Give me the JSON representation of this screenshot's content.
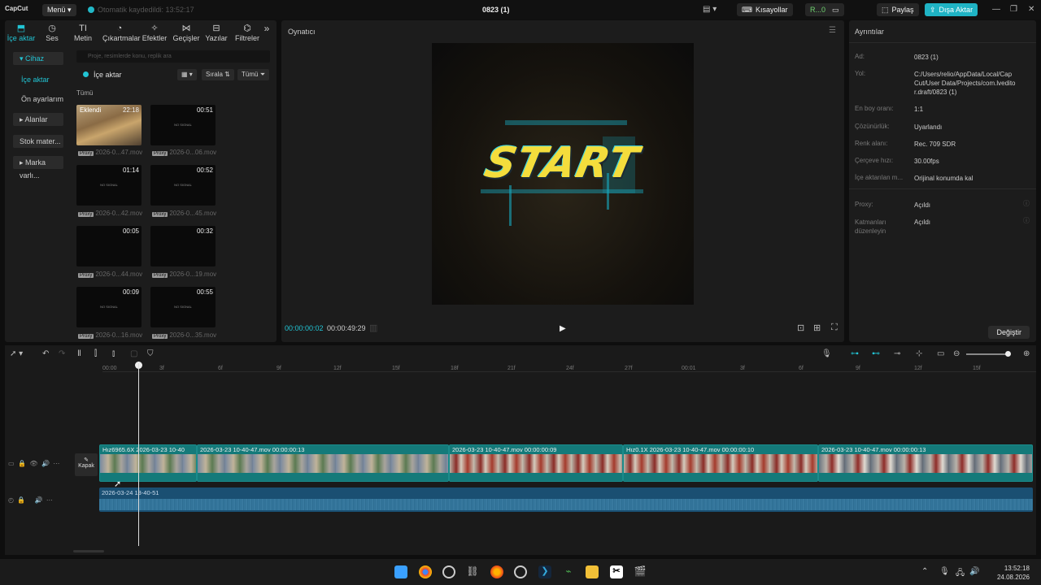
{
  "titlebar": {
    "logo": "CapCut",
    "menu": "Menü",
    "autosave": "Otomatik kaydedildi: 13:52:17",
    "project_title": "0823 (1)",
    "shortcuts": "Kısayollar",
    "ai_label": "R...0",
    "share": "Paylaş",
    "export": "Dışa Aktar"
  },
  "media_panel": {
    "tabs": [
      {
        "label": "İçe aktar",
        "icon": "import-icon"
      },
      {
        "label": "Ses",
        "icon": "audio-icon"
      },
      {
        "label": "Metin",
        "icon": "text-icon"
      },
      {
        "label": "Çıkartmalar",
        "icon": "sticker-icon"
      },
      {
        "label": "Efektler",
        "icon": "effects-icon"
      },
      {
        "label": "Geçişler",
        "icon": "transitions-icon"
      },
      {
        "label": "Yazılar",
        "icon": "captions-icon"
      },
      {
        "label": "Filtreler",
        "icon": "filters-icon"
      }
    ],
    "sidebar": [
      "Cihaz",
      "İçe aktar",
      "Ön ayarlarım",
      "Alanlar",
      "Stok mater...",
      "Marka varlı..."
    ],
    "search_placeholder": "Proje, resimlerde konu, replik ara",
    "import_label": "İçe aktar",
    "sort_label": "Sırala",
    "filter_label": "Tümü",
    "all_label": "Tümü",
    "items": [
      {
        "duration": "22:18",
        "name": "2026-0...47.mov",
        "proxy": "Proxy",
        "added": "Eklendi"
      },
      {
        "duration": "00:51",
        "name": "2026-0...06.mov",
        "proxy": "Proxy"
      },
      {
        "duration": "01:14",
        "name": "2026-0...42.mov",
        "proxy": "Proxy"
      },
      {
        "duration": "00:52",
        "name": "2026-0...45.mov",
        "proxy": "Proxy"
      },
      {
        "duration": "00:05",
        "name": "2026-0...44.mov",
        "proxy": "Proxy"
      },
      {
        "duration": "00:32",
        "name": "2026-0...19.mov",
        "proxy": "Proxy"
      },
      {
        "duration": "00:09",
        "name": "2026-0...16.mov",
        "proxy": "Proxy"
      },
      {
        "duration": "00:55",
        "name": "2026-0...35.mov",
        "proxy": "Proxy"
      }
    ],
    "no_signal": "NO SIGNAL"
  },
  "player": {
    "title": "Oynatıcı",
    "overlay_text": "START",
    "current_time": "00:00:00:02",
    "total_time": "00:00:49:29"
  },
  "details": {
    "title": "Ayrıntılar",
    "rows": [
      {
        "key": "Ad:",
        "value": "0823 (1)"
      },
      {
        "key": "Yol:",
        "value": "C:/Users/relio/AppData/Local/CapCut/User Data/Projects/com.lveditor.draft/0823 (1)"
      },
      {
        "key": "En boy oranı:",
        "value": "1:1"
      },
      {
        "key": "Çözünürlük:",
        "value": "Uyarlandı"
      },
      {
        "key": "Renk alanı:",
        "value": "Rec. 709 SDR"
      },
      {
        "key": "Çerçeve hızı:",
        "value": "30.00fps"
      },
      {
        "key": "İçe aktarılan m...",
        "value": "Orijinal konumda kal"
      },
      {
        "key": "Proxy:",
        "value": "Açıldı"
      },
      {
        "key": "Katmanları düzenleyin",
        "value": "Açıldı"
      }
    ],
    "change_button": "Değiştir"
  },
  "timeline": {
    "ruler_ticks": [
      "00:00",
      "3f",
      "6f",
      "9f",
      "12f",
      "15f",
      "18f",
      "21f",
      "24f",
      "27f",
      "00:01",
      "3f",
      "6f",
      "9f",
      "12f",
      "15f"
    ],
    "cover_label": "Kapak",
    "clips": [
      {
        "label": "Hız6965.6X   2026-03-23 10-40",
        "style": "frames"
      },
      {
        "label": "2026-03-23 10-40-47.mov   00:00:00:13",
        "style": "frames"
      },
      {
        "label": "2026-03-23 10-40-47.mov   00:00:00:09",
        "style": "red"
      },
      {
        "label": "Hız0.1X   2026-03-23 10-40-47.mov   00:00:00:10",
        "style": "red"
      },
      {
        "label": "2026-03-23 10-40-47.mov   00:00:00:13",
        "style": "mix"
      }
    ],
    "audio_label": "2026-03-24 13-40-51"
  },
  "taskbar": {
    "time": "13:52:18",
    "date": "24.08.2026"
  },
  "colors": {
    "accent": "#22c4d4",
    "clip": "#147a7a",
    "audio": "#1a4f72"
  }
}
